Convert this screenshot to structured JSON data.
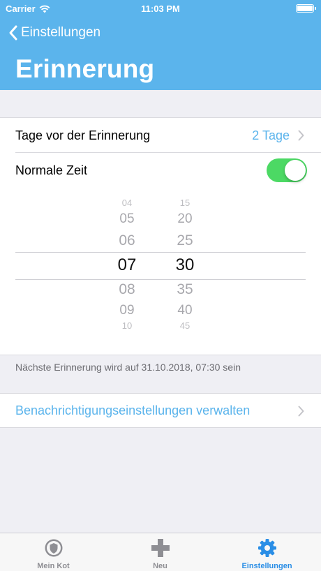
{
  "status_bar": {
    "carrier": "Carrier",
    "time": "11:03 PM"
  },
  "nav": {
    "back_label": "Einstellungen",
    "title": "Erinnerung"
  },
  "settings": {
    "days_label": "Tage vor der Erinnerung",
    "days_value": "2 Tage",
    "normal_time_label": "Normale Zeit",
    "normal_time_enabled": true
  },
  "picker": {
    "hours": [
      "04",
      "05",
      "06",
      "07",
      "08",
      "09",
      "10"
    ],
    "minutes": [
      "15",
      "20",
      "25",
      "30",
      "35",
      "40",
      "45"
    ],
    "selected_hour": "07",
    "selected_minute": "30"
  },
  "footer_note": "Nächste Erinnerung wird auf 31.10.2018, 07:30 sein",
  "notification_link": "Benachrichtigungseinstellungen verwalten",
  "tabs": [
    {
      "label": "Mein Kot",
      "icon": "shield-icon"
    },
    {
      "label": "Neu",
      "icon": "plus-icon"
    },
    {
      "label": "Einstellungen",
      "icon": "gear-icon"
    }
  ],
  "colors": {
    "accent": "#5bb4ec",
    "toggle_on": "#4cd964",
    "tab_active": "#2a8ee6"
  }
}
